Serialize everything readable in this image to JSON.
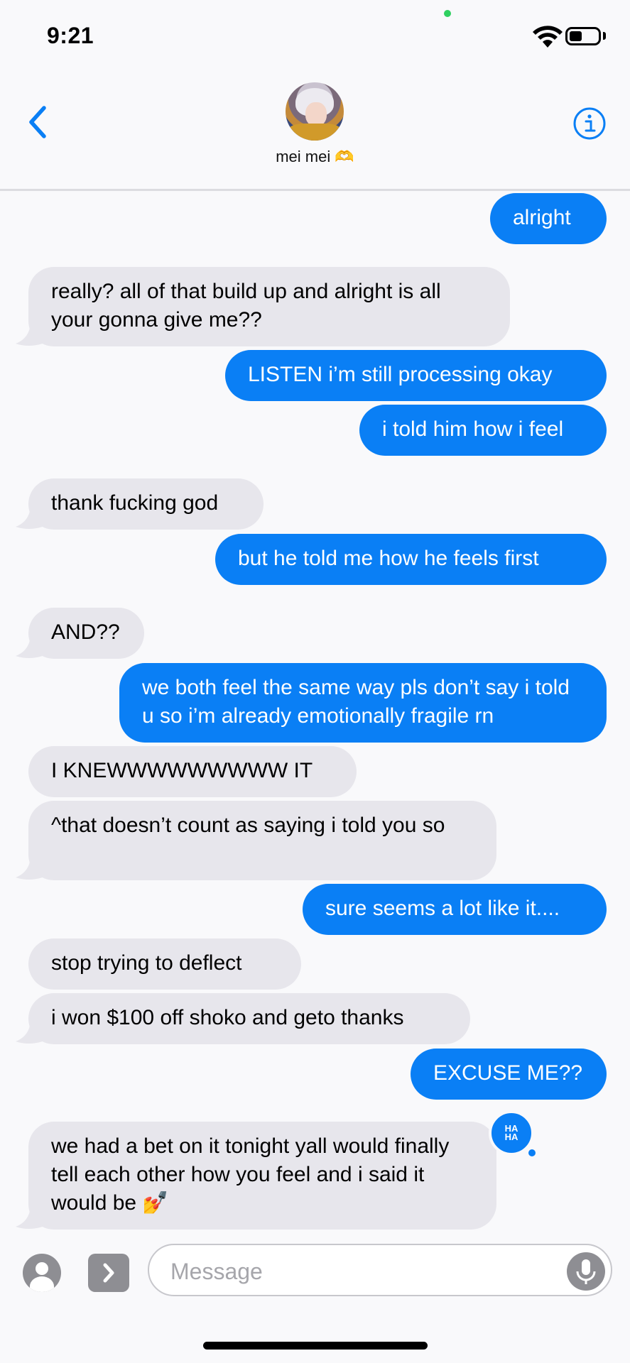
{
  "status_bar": {
    "time": "9:21",
    "battery_level": 0.45
  },
  "header": {
    "contact_name": "mei mei 🫶",
    "back_icon": "chevron-left-icon",
    "info_icon": "info-icon"
  },
  "messages": [
    {
      "from": "me",
      "text": "alright"
    },
    {
      "from": "them",
      "text": "really? all of that build up and alright is all your gonna give me??"
    },
    {
      "from": "me",
      "text": "LISTEN i’m still processing okay"
    },
    {
      "from": "me",
      "text": "i told him how i feel"
    },
    {
      "from": "them",
      "text": "thank fucking god"
    },
    {
      "from": "me",
      "text": "but he told me how he feels first"
    },
    {
      "from": "them",
      "text": "AND??"
    },
    {
      "from": "me",
      "text": "we both feel the same way pls don’t say i told u so i’m already emotionally fragile rn"
    },
    {
      "from": "them",
      "text": "I KNEWWWWWWWWW IT"
    },
    {
      "from": "them",
      "text": "^that doesn’t count as saying i told you so"
    },
    {
      "from": "me",
      "text": "sure seems a lot like it...."
    },
    {
      "from": "them",
      "text": "stop trying to deflect"
    },
    {
      "from": "them",
      "text": "i won $100 off shoko and geto thanks"
    },
    {
      "from": "me",
      "text": "EXCUSE ME??"
    },
    {
      "from": "them",
      "text": "we had a bet on it tonight yall would finally tell each other how you feel and i said it would be 💅",
      "reaction": "HA HA"
    }
  ],
  "input": {
    "placeholder": "Message"
  },
  "colors": {
    "outgoing": "#0a7ff5",
    "incoming": "#e7e6ec",
    "accent": "#0a7ff5"
  }
}
